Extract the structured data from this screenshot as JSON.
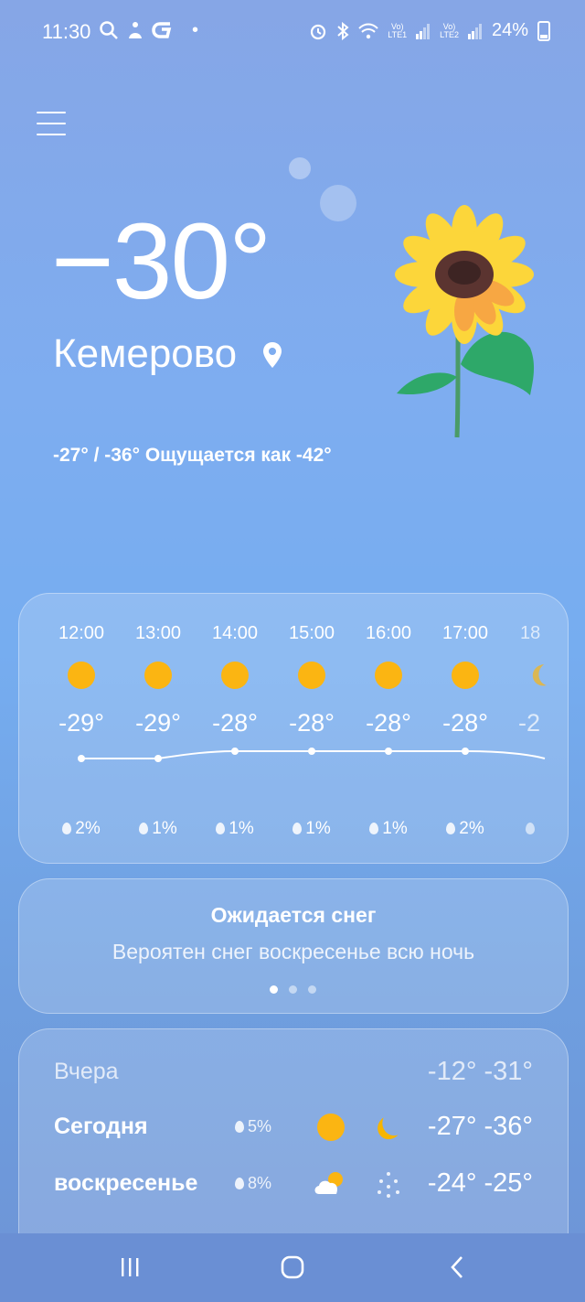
{
  "status_bar": {
    "time": "11:30",
    "left_icons": [
      "search-icon",
      "app-icon",
      "g-icon",
      "dot-icon"
    ],
    "right_icons": [
      "alarm-icon",
      "bluetooth-icon",
      "wifi-icon",
      "signal-lte1-icon",
      "signal-lte2-icon"
    ],
    "lte1": "LTE1",
    "lte2": "LTE2",
    "battery": "24%"
  },
  "current": {
    "temperature": "−30°",
    "city": "Кемерово",
    "minmax_feels": "-27° / -36° Ощущается как -42°"
  },
  "hourly": [
    {
      "time": "12:00",
      "temp": "-29°",
      "precip": "2%",
      "icon": "sun-icon"
    },
    {
      "time": "13:00",
      "temp": "-29°",
      "precip": "1%",
      "icon": "sun-icon"
    },
    {
      "time": "14:00",
      "temp": "-28°",
      "precip": "1%",
      "icon": "sun-icon"
    },
    {
      "time": "15:00",
      "temp": "-28°",
      "precip": "1%",
      "icon": "sun-icon"
    },
    {
      "time": "16:00",
      "temp": "-28°",
      "precip": "1%",
      "icon": "sun-icon"
    },
    {
      "time": "17:00",
      "temp": "-28°",
      "precip": "2%",
      "icon": "sun-icon"
    },
    {
      "time": "18",
      "temp": "-2",
      "precip": "",
      "icon": "moon-icon"
    }
  ],
  "alert": {
    "title": "Ожидается снег",
    "subtitle": "Вероятен снег воскресенье всю ночь",
    "page_index": 1,
    "page_count": 3
  },
  "daily": [
    {
      "day": "Вчера",
      "precip": "",
      "temps": "-12° -31°",
      "day_icon": "",
      "night_icon": ""
    },
    {
      "day": "Сегодня",
      "precip": "5%",
      "temps": "-27° -36°",
      "day_icon": "sun-icon",
      "night_icon": "moon-icon"
    },
    {
      "day": "воскресенье",
      "precip": "8%",
      "temps": "-24° -25°",
      "day_icon": "partly-cloudy-icon",
      "night_icon": "snow-icon"
    }
  ],
  "colors": {
    "sun": "#fbb512",
    "moon": "#f7b500"
  }
}
